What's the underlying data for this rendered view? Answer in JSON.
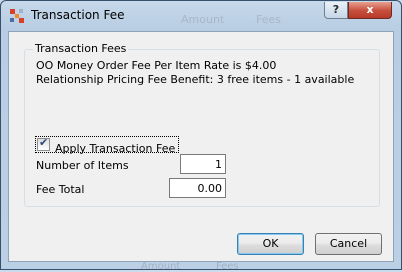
{
  "window": {
    "title": "Transaction Fee",
    "help_label": "?",
    "close_label": "x",
    "background_ghost_text": [
      "Amount",
      "Fees"
    ],
    "background_ghost_bottom": [
      "Amount",
      "Fees"
    ]
  },
  "group": {
    "title": "Transaction Fees",
    "rate_text": "OO Money Order Fee Per Item Rate is $4.00",
    "benefit_text": "Relationship Pricing Fee Benefit: 3 free items - 1 available"
  },
  "apply_fee": {
    "label": "Apply Transaction Fee",
    "checked": true
  },
  "fields": {
    "number_of_items_label": "Number of Items",
    "number_of_items_value": "1",
    "fee_total_label": "Fee Total",
    "fee_total_value": "0.00"
  },
  "buttons": {
    "ok": "OK",
    "cancel": "Cancel"
  },
  "colors": {
    "frame": "#bcd0e5",
    "client": "#f0f0f0",
    "close_button": "#c74d3b",
    "default_button_border": "#3c7fb1"
  }
}
